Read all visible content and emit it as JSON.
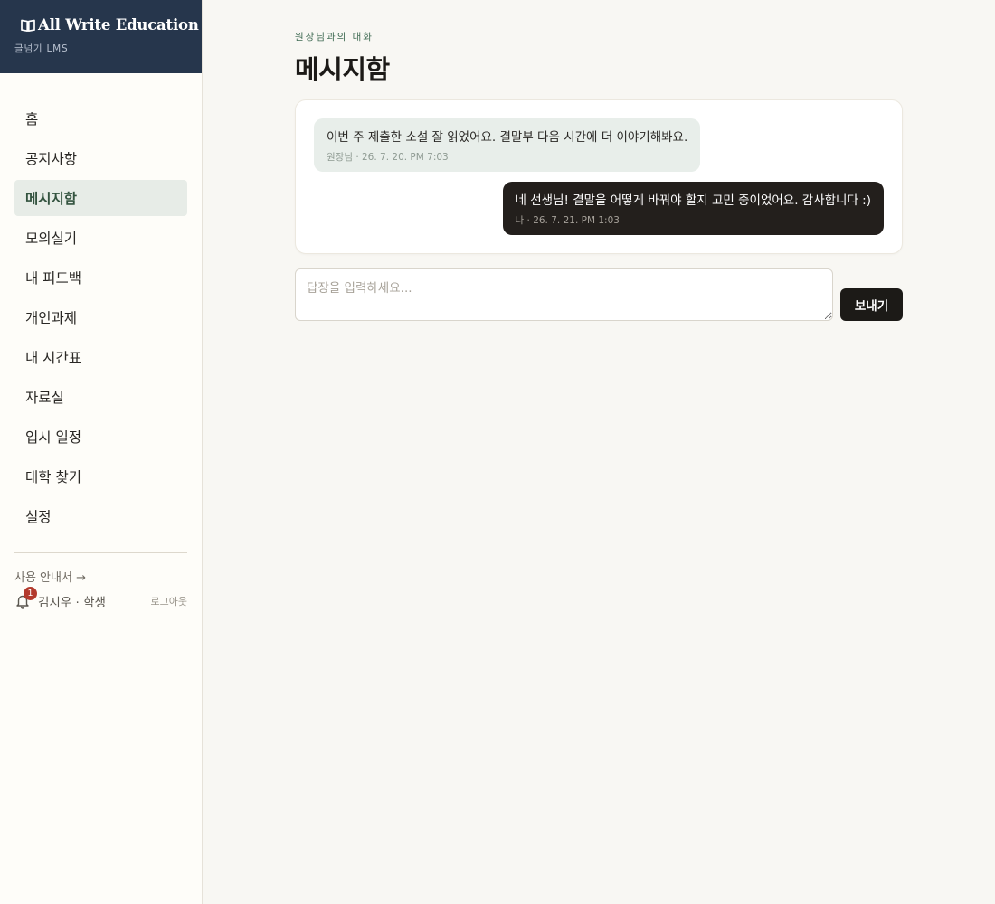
{
  "brand": {
    "title": "All Write Education",
    "subtitle": "글넘기 LMS",
    "icon": "open-book-icon",
    "background": "#26364c"
  },
  "sidebar": {
    "items": [
      {
        "label": "홈"
      },
      {
        "label": "공지사항"
      },
      {
        "label": "메시지함",
        "active": true
      },
      {
        "label": "모의실기"
      },
      {
        "label": "내 피드백"
      },
      {
        "label": "개인과제"
      },
      {
        "label": "내 시간표"
      },
      {
        "label": "자료실"
      },
      {
        "label": "입시 일정"
      },
      {
        "label": "대학 찾기"
      },
      {
        "label": "설정"
      }
    ],
    "guide_link": "사용 안내서 →",
    "notifications": {
      "icon": "bell-icon",
      "count": "1"
    },
    "user": "김지우 · 학생",
    "logout": "로그아웃"
  },
  "main": {
    "eyebrow": "원장님과의 대화",
    "title": "메시지함",
    "messages": [
      {
        "direction": "in",
        "text": "이번 주 제출한 소설 잘 읽었어요. 결말부 다음 시간에 더 이야기해봐요.",
        "meta": "원장님 · 26. 7. 20. PM 7:03"
      },
      {
        "direction": "out",
        "text": "네 선생님! 결말을 어떻게 바꿔야 할지 고민 중이었어요. 감사합니다 :)",
        "meta": "나 · 26. 7. 21. PM 1:03"
      }
    ],
    "reply": {
      "placeholder": "답장을 입력하세요...",
      "value": "",
      "send_label": "보내기"
    }
  },
  "colors": {
    "accent_green": "#33533f",
    "active_bg": "#e7ece7",
    "incoming_bubble": "#e8eeea",
    "outgoing_bubble": "#231f1c",
    "badge": "#b33a2d"
  }
}
